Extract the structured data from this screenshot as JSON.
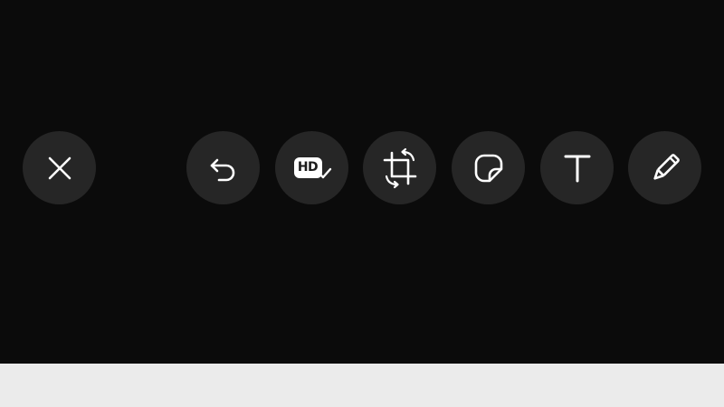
{
  "editor": {
    "background_color": "#0b0b0b",
    "button_color": "#262626",
    "icon_color": "#ffffff",
    "sheet_color": "#ebebeb"
  },
  "toolbar": {
    "close": {
      "icon": "close-icon"
    },
    "undo": {
      "icon": "undo-icon"
    },
    "hd": {
      "icon": "hd-icon",
      "label": "HD",
      "checked": true
    },
    "crop_rotate": {
      "icon": "crop-rotate-icon"
    },
    "sticker": {
      "icon": "sticker-icon"
    },
    "text": {
      "icon": "text-icon",
      "glyph": "T"
    },
    "draw": {
      "icon": "pencil-icon"
    }
  }
}
